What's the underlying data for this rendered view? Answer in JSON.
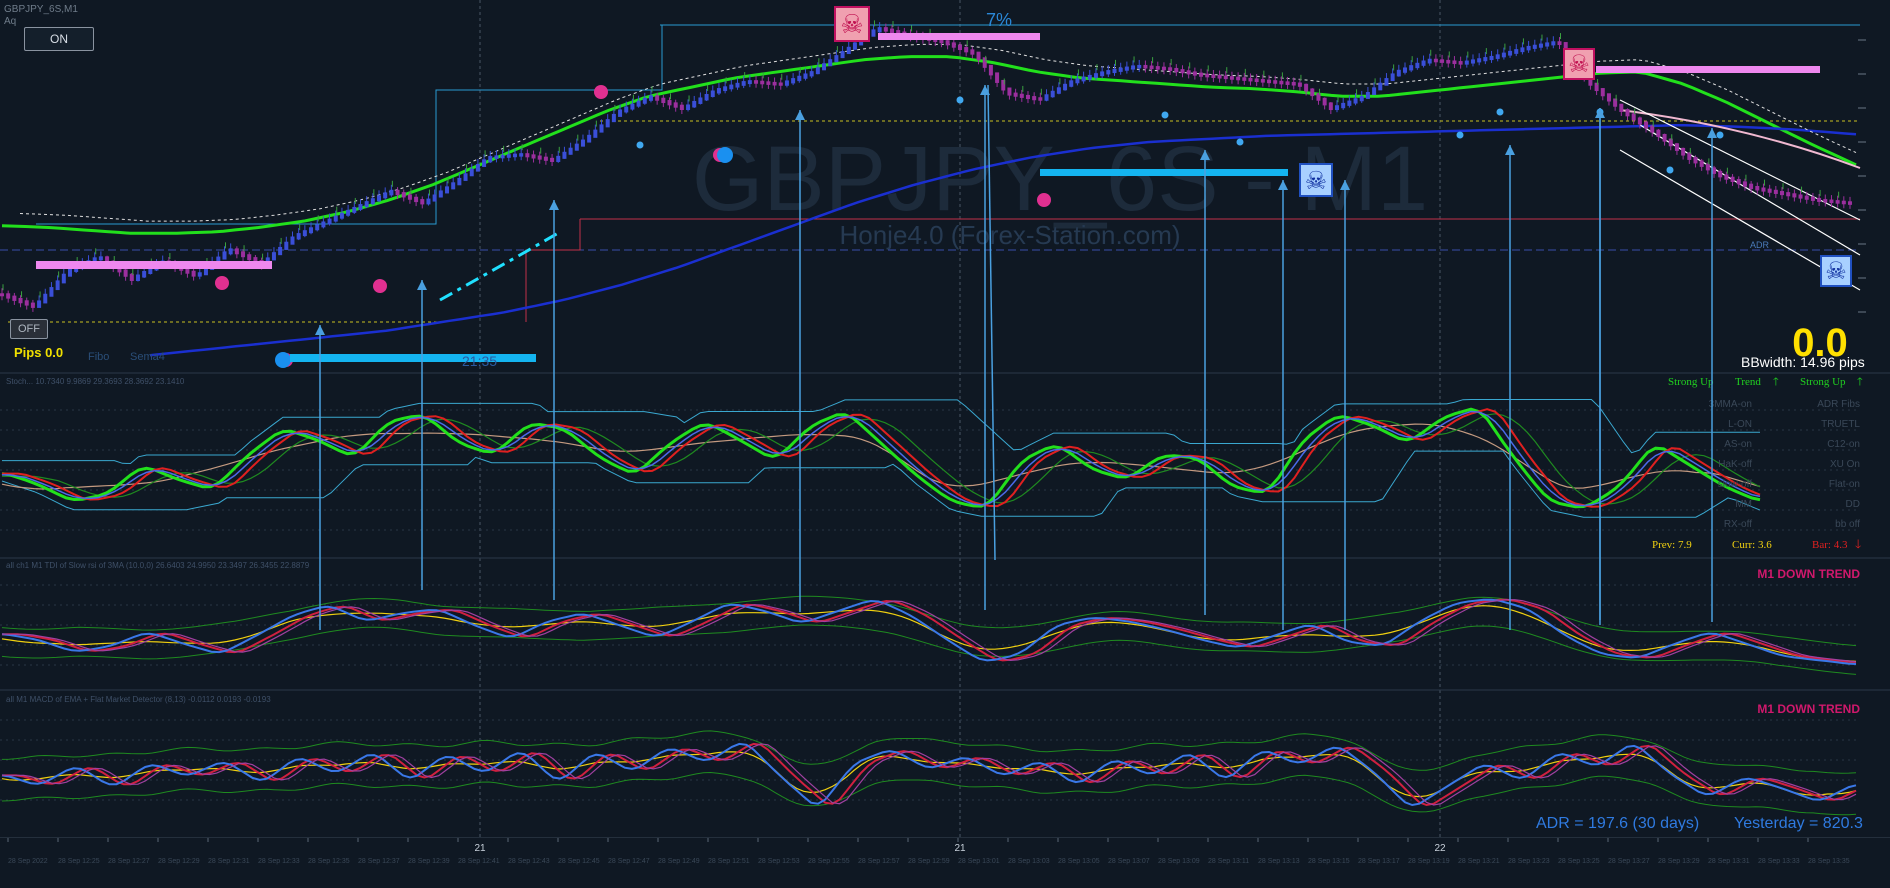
{
  "header": {
    "symbol_label": "GBPJPY_6S,M1",
    "sub_label": "Aq",
    "on_button": "ON",
    "off_button": "OFF",
    "percent_text": "7%"
  },
  "watermark": {
    "title": "GBPJPY_6S - M1",
    "subtitle": "Honje4.0 (Forex-Station.com)"
  },
  "main_panel": {
    "pips_label": "Pips 0.0",
    "fibo_label": "Fibo",
    "sema_label": "Sema4",
    "time_label": "21:35",
    "big_value": "0.0",
    "bbwidth": "BBwidth: 14.96 pips",
    "adr_side_label": "ADR"
  },
  "panel2": {
    "title": "Stoch... 10.7340 9.9869 29.3693 28.3692 23.1410",
    "strong_up_1": "Strong Up",
    "trend": "Trend",
    "strong_up_2": "Strong Up",
    "grid_labels": [
      [
        "3MMA-on",
        "ADR Fibs"
      ],
      [
        "L-ON",
        "TRUETL"
      ],
      [
        "AS-on",
        "C12-on"
      ],
      [
        "HaK-off",
        "XU On"
      ],
      [
        "slow-off",
        "Flat-on"
      ],
      [
        "MM",
        "DD"
      ],
      [
        "RX-off",
        "bb off"
      ]
    ],
    "prev": "Prev: 7.9",
    "curr": "Curr: 3.6",
    "bar": "Bar: 4.3"
  },
  "panel3": {
    "title": "all ch1 M1 TDI of Slow rsi of 3MA (10.0,0) 26.6403 24.9950 23.3497 26.3455 22.8879",
    "trend_label": "M1 DOWN TREND"
  },
  "panel4": {
    "title": "all M1 MACD of EMA + Flat Market Detector (8,13) -0.0112 0.0193 -0.0193",
    "trend_label": "M1 DOWN TREND",
    "adr": "ADR = 197.6  (30 days)",
    "yesterday": "Yesterday = 820.3"
  },
  "x_axis": {
    "day_labels": [
      "21",
      "21",
      "22"
    ],
    "time_ticks": [
      "28 Sep 2022",
      "28 Sep 12:25",
      "28 Sep 12:27",
      "28 Sep 12:29",
      "28 Sep 12:31",
      "28 Sep 12:33",
      "28 Sep 12:35",
      "28 Sep 12:37",
      "28 Sep 12:39",
      "28 Sep 12:41",
      "28 Sep 12:43",
      "28 Sep 12:45",
      "28 Sep 12:47",
      "28 Sep 12:49",
      "28 Sep 12:51",
      "28 Sep 12:53",
      "28 Sep 12:55",
      "28 Sep 12:57",
      "28 Sep 12:59",
      "28 Sep 13:01",
      "28 Sep 13:03",
      "28 Sep 13:05",
      "28 Sep 13:07",
      "28 Sep 13:09",
      "28 Sep 13:11",
      "28 Sep 13:13",
      "28 Sep 13:15",
      "28 Sep 13:17",
      "28 Sep 13:19",
      "28 Sep 13:21",
      "28 Sep 13:23",
      "28 Sep 13:25",
      "28 Sep 13:27",
      "28 Sep 13:29",
      "28 Sep 13:31",
      "28 Sep 13:33",
      "28 Sep 13:35"
    ]
  },
  "colors": {
    "background": "#0f1823",
    "green_line": "#22e01c",
    "blue_line": "#1a2fd0",
    "candle_magenta": "#9b2f9e",
    "candle_blue": "#3a4fd8",
    "signal_arrow": "#4aa0e0",
    "cyan_bar": "#14b4f0",
    "pink_bar": "#ee88ee",
    "trend_red": "#d0186c",
    "yellow": "#f0d010",
    "red": "#e02020",
    "tan": "#c49a80"
  },
  "chart_data": {
    "type": "line",
    "title": "GBPJPY_6S - M1",
    "price_path": [
      30,
      22,
      45,
      55,
      40,
      52,
      42,
      60,
      50,
      68,
      78,
      88,
      98,
      90,
      104,
      120,
      122,
      118,
      132,
      150,
      160,
      152,
      164,
      170,
      168,
      176,
      190,
      205,
      200,
      196,
      188,
      162,
      158,
      170,
      176,
      180,
      178,
      174,
      172,
      170,
      168,
      152,
      160,
      176,
      184,
      182,
      186,
      192,
      196,
      168,
      150,
      136,
      120,
      108,
      100,
      96,
      92,
      90
    ],
    "green_ma": [
      75,
      74,
      72,
      70,
      70,
      71,
      74,
      78,
      84,
      92,
      102,
      114,
      126,
      138,
      150,
      160,
      166,
      172,
      176,
      180,
      184,
      186,
      186,
      182,
      176,
      172,
      170,
      168,
      166,
      165,
      163,
      160,
      160,
      163,
      166,
      169,
      172,
      175,
      176,
      168,
      156,
      142,
      128,
      115
    ],
    "blue_ma": [
      0,
      4,
      8,
      12,
      16,
      22,
      28,
      36,
      46,
      58,
      72,
      86,
      100,
      112,
      122,
      130,
      136,
      140,
      142,
      144,
      145,
      146,
      147,
      148,
      149,
      150,
      151,
      150,
      148,
      145
    ],
    "signal_arrow_count": 16,
    "stoch": [
      50,
      42,
      30,
      35,
      55,
      45,
      38,
      62,
      80,
      72,
      60,
      85,
      90,
      70,
      62,
      84,
      80,
      60,
      48,
      70,
      85,
      72,
      58,
      82,
      92,
      70,
      48,
      30,
      25,
      58,
      70,
      52,
      45,
      62,
      60,
      40,
      35,
      72,
      90,
      82,
      70,
      88,
      95,
      60,
      30,
      25,
      40,
      70,
      55,
      40,
      30
    ],
    "tdi": [
      50,
      44,
      32,
      38,
      52,
      40,
      30,
      48,
      68,
      78,
      62,
      70,
      74,
      58,
      45,
      62,
      70,
      58,
      46,
      62,
      80,
      72,
      60,
      72,
      84,
      68,
      44,
      22,
      30,
      58,
      66,
      62,
      54,
      44,
      36,
      48,
      60,
      42,
      38,
      62,
      80,
      84,
      74,
      48,
      30,
      26,
      40,
      52,
      40,
      28,
      24,
      20
    ],
    "macd": [
      50,
      40,
      58,
      38,
      60,
      48,
      62,
      42,
      66,
      50,
      70,
      44,
      68,
      50,
      72,
      42,
      70,
      52,
      74,
      60,
      80,
      48,
      20,
      60,
      72,
      54,
      66,
      48,
      62,
      40,
      64,
      48,
      70,
      44,
      72,
      58,
      76,
      52,
      20,
      40,
      60,
      44,
      70,
      56,
      78,
      50,
      30,
      48,
      38,
      26,
      42
    ]
  }
}
